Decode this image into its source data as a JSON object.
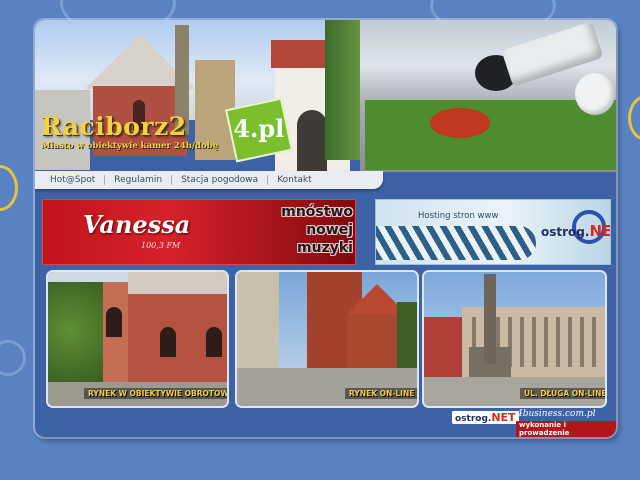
{
  "header": {
    "logo_main": "Raciborz2",
    "logo_badge": "4.pl",
    "tagline": "Miasto w obiektywie kamer 24h/dobę"
  },
  "nav": {
    "items": [
      {
        "label": "Hot@Spot"
      },
      {
        "label": "Regulamin"
      },
      {
        "label": "Stacja pogodowa"
      },
      {
        "label": "Kontakt"
      }
    ]
  },
  "banners": {
    "vanessa": {
      "logo": "Vanessa",
      "frequency": "100,3 FM",
      "slogan_line1": "mnóstwo",
      "slogan_line2": "nowej",
      "slogan_line3": "muzyki"
    },
    "ostrog": {
      "text": "Hosting stron www",
      "logo_prefix": "ostrog.",
      "logo_suffix": "NET"
    }
  },
  "tiles": [
    {
      "label": "RYNEK W OBIEKTYWIE OBROTOWYM"
    },
    {
      "label": "RYNEK ON-LINE"
    },
    {
      "label": "UL. DŁUGA ON-LINE"
    }
  ],
  "footer": {
    "ostrog_prefix": "ostrog.",
    "ostrog_suffix": "NET",
    "business": "4business.com.pl",
    "credit": "wykonanie i prowadzenie"
  },
  "colors": {
    "background": "#5a82c2",
    "card": "#3d63a6",
    "logo_yellow": "#f5d23a",
    "badge_green": "#7bbf2e",
    "vanessa_red": "#d8212a",
    "ostrog_red": "#d82b20"
  }
}
